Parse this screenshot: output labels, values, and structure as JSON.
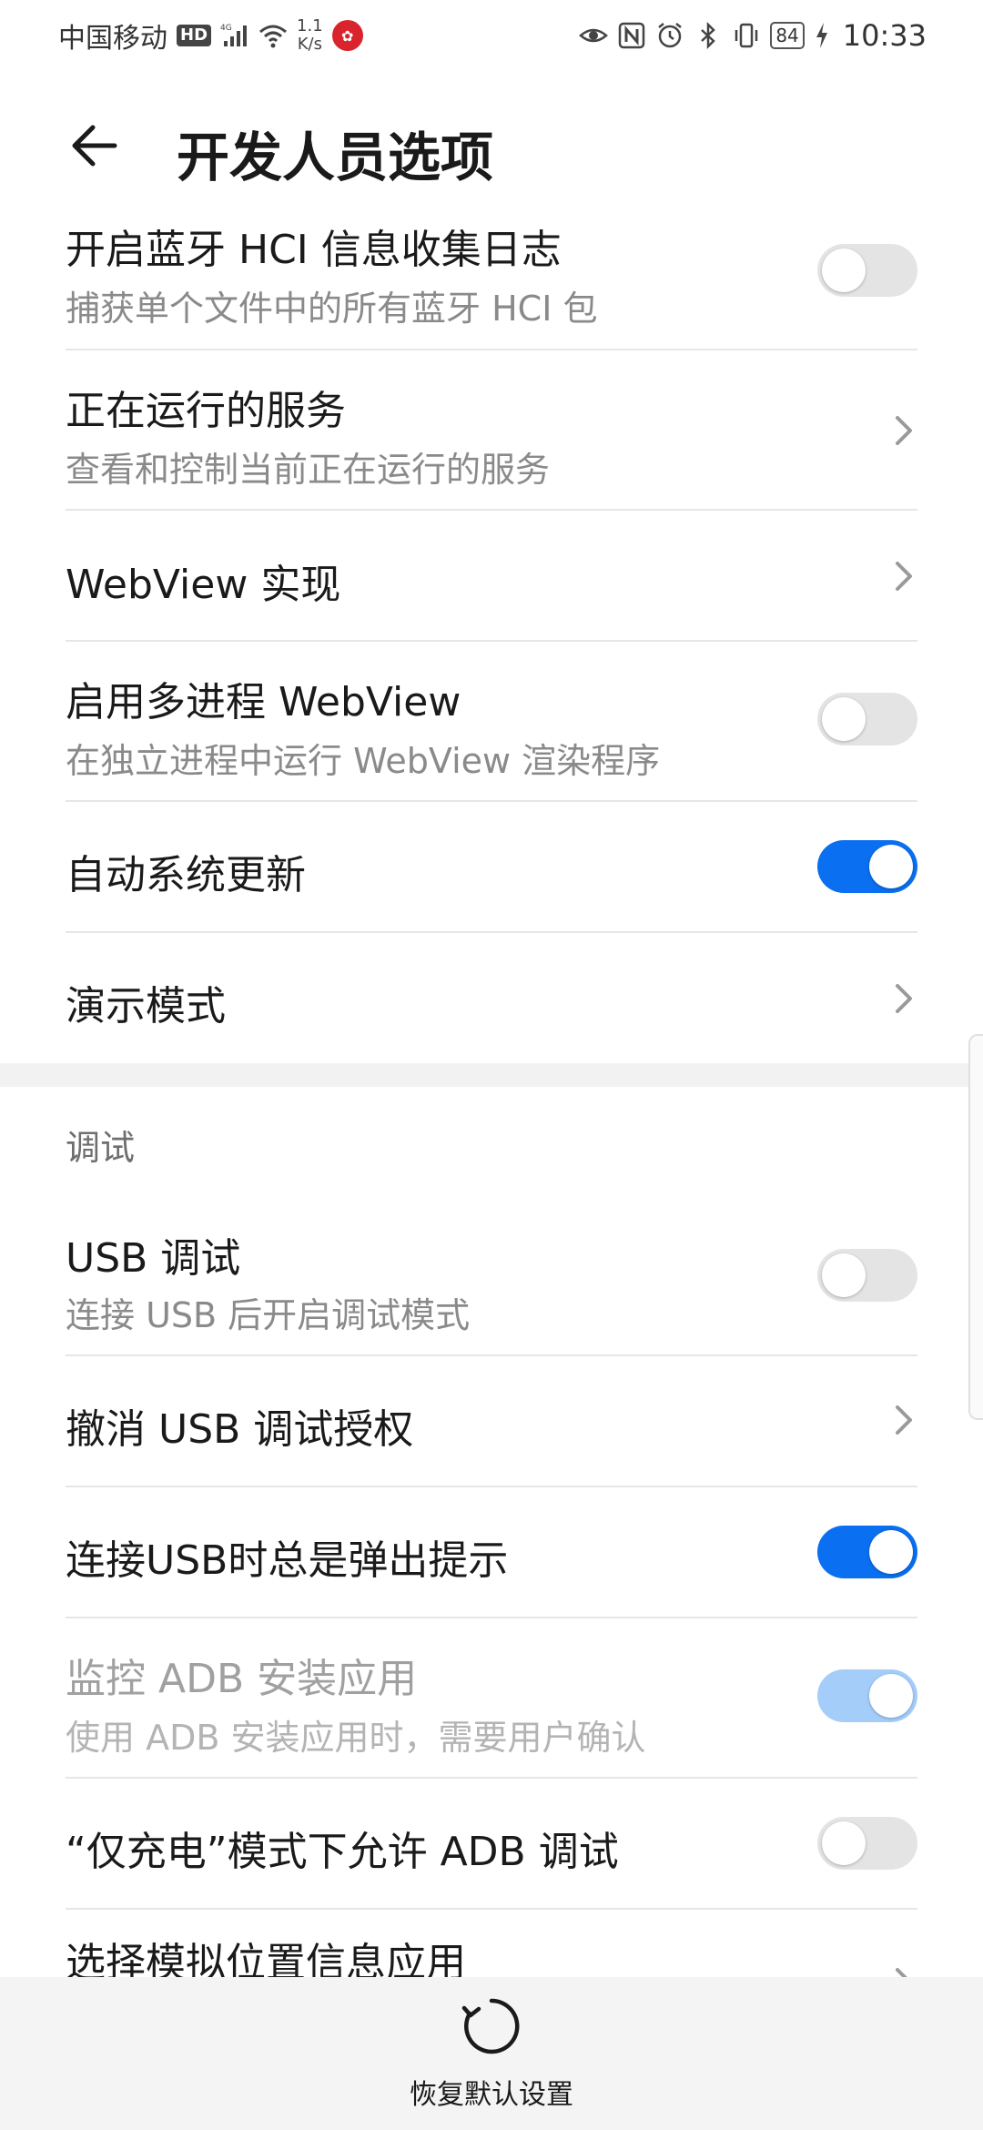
{
  "status_bar": {
    "carrier": "中国移动",
    "hd_badge": "HD",
    "signal_label": "4G",
    "net_speed_value": "1.1",
    "net_speed_unit": "K/s",
    "battery": "84",
    "time": "10:33"
  },
  "header": {
    "title": "开发人员选项"
  },
  "rows": [
    {
      "title": "开启蓝牙 HCI 信息收集日志",
      "subtitle": "捕获单个文件中的所有蓝牙 HCI 包",
      "control": "toggle",
      "on": false
    },
    {
      "title": "正在运行的服务",
      "subtitle": "查看和控制当前正在运行的服务",
      "control": "chevron"
    },
    {
      "title": "WebView 实现",
      "control": "chevron"
    },
    {
      "title": "启用多进程 WebView",
      "subtitle": "在独立进程中运行 WebView 渲染程序",
      "control": "toggle",
      "on": false
    },
    {
      "title": "自动系统更新",
      "control": "toggle",
      "on": true
    },
    {
      "title": "演示模式",
      "control": "chevron"
    }
  ],
  "debug_section": {
    "header": "调试",
    "rows": [
      {
        "title": "USB 调试",
        "subtitle": "连接 USB 后开启调试模式",
        "control": "toggle",
        "on": false
      },
      {
        "title": "撤消 USB 调试授权",
        "control": "chevron"
      },
      {
        "title": "连接USB时总是弹出提示",
        "control": "toggle",
        "on": true
      },
      {
        "title": "监控 ADB 安装应用",
        "subtitle": "使用 ADB 安装应用时，需要用户确认",
        "control": "toggle",
        "on": true,
        "disabled": true
      },
      {
        "title": "“仅充电”模式下允许 ADB 调试",
        "control": "toggle",
        "on": false
      },
      {
        "title": "选择模拟位置信息应用",
        "control": "chevron"
      }
    ]
  },
  "bottom_bar": {
    "reset_label": "恢复默认设置"
  },
  "colors": {
    "accent": "#0a6ff0",
    "accent_disabled": "#a4cdfa",
    "toggle_off": "#e4e4e4"
  }
}
